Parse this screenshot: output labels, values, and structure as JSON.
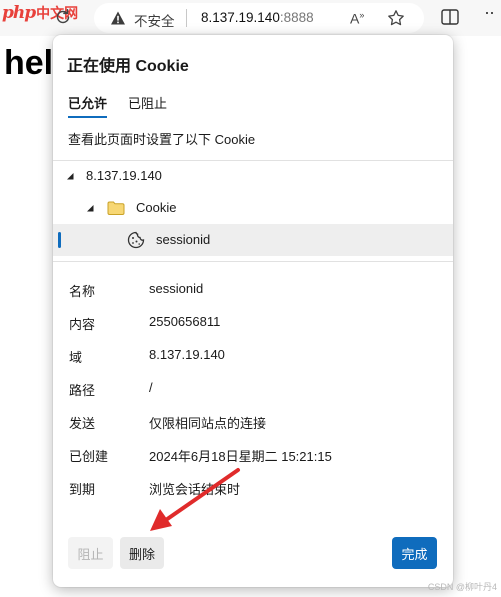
{
  "toolbar": {
    "logo_latin": "php",
    "logo_cn": "中文网",
    "insecure_label": "不安全",
    "url_host": "8.137.19.140",
    "url_port": ":8888",
    "readaloud_glyph": "A̅"
  },
  "page": {
    "visible_text": "hel"
  },
  "popup": {
    "title": "正在使用 Cookie",
    "tabs": [
      {
        "label": "已允许",
        "active": true
      },
      {
        "label": "已阻止",
        "active": false
      }
    ],
    "description": "查看此页面时设置了以下 Cookie",
    "tree": {
      "site": "8.137.19.140",
      "folder": "Cookie",
      "cookie": "sessionid"
    },
    "details": [
      {
        "label": "名称",
        "value": "sessionid"
      },
      {
        "label": "内容",
        "value": "2550656811"
      },
      {
        "label": "域",
        "value": "8.137.19.140"
      },
      {
        "label": "路径",
        "value": "/"
      },
      {
        "label": "发送",
        "value": "仅限相同站点的连接"
      },
      {
        "label": "已创建",
        "value": "2024年6月18日星期二 15:21:15"
      },
      {
        "label": "到期",
        "value": "浏览会话结束时"
      }
    ],
    "buttons": {
      "block": "阻止",
      "delete": "删除",
      "done": "完成"
    }
  },
  "watermark": "CSDN @柳叶丹4",
  "colors": {
    "accent": "#0f6cbd",
    "annotation_arrow": "#e02b2b",
    "logo": "#e8413b"
  }
}
